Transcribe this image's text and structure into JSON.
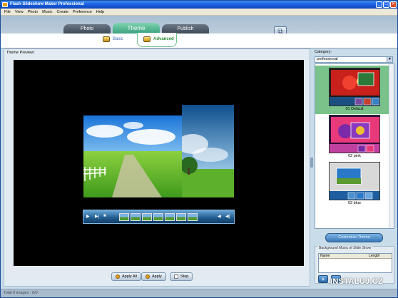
{
  "window": {
    "title": "Flash Slideshow Maker Professional",
    "minimize": "_",
    "maximize": "□",
    "close": "×"
  },
  "menu": [
    "File",
    "View",
    "Photo",
    "Music",
    "Create",
    "Preference",
    "Help"
  ],
  "tabs": {
    "photo": "Photo",
    "theme": "Theme",
    "publish": "Publish"
  },
  "subtabs": {
    "basic": "Basic",
    "advanced": "Advanced"
  },
  "preview": {
    "label": "Theme Preview:"
  },
  "player": {
    "play": "▶",
    "next": "▶|",
    "stop": "■",
    "prev": "◀",
    "prevAlt": "◀|"
  },
  "actions": {
    "apply_all": "Apply All",
    "apply": "Apply",
    "stop": "Stop"
  },
  "category": {
    "label": "Category:",
    "selected": "professional"
  },
  "themes": [
    {
      "name": "01 Default"
    },
    {
      "name": "02 pink"
    },
    {
      "name": "03 blue"
    }
  ],
  "customize": {
    "label": "Customize Theme"
  },
  "background": {
    "group_label": "Background Music of Slide Show",
    "col_name": "Name",
    "col_length": "Length",
    "add": "+",
    "remove": "−"
  },
  "status": {
    "text": "Total 0 images : 0/0"
  },
  "watermark": "INSTALUJ.CZ",
  "colors": {
    "accent": "#3ba27f",
    "selected_theme": "#79c28a",
    "titlebar": "#1658d6"
  }
}
